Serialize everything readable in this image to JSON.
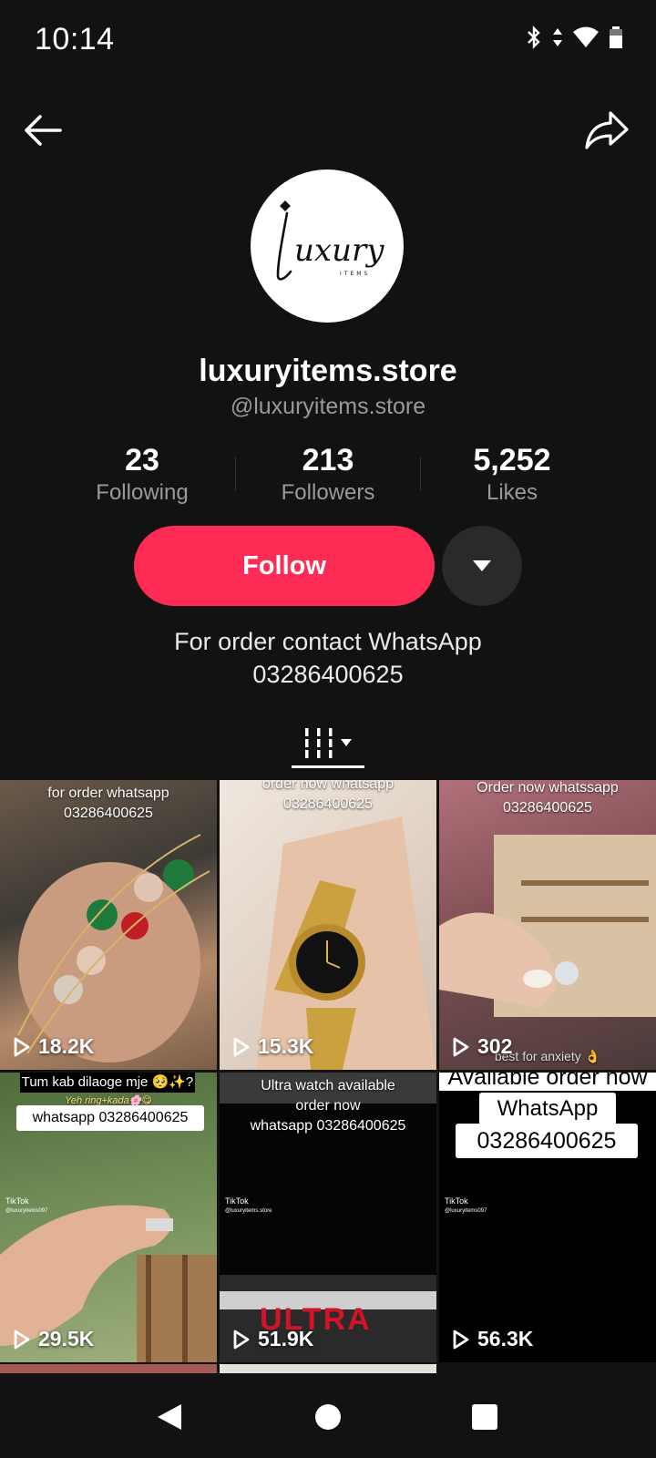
{
  "status_bar": {
    "time": "10:14"
  },
  "profile": {
    "display_name": "luxuryitems.store",
    "handle": "@luxuryitems.store",
    "logo_text": "luxury",
    "logo_subtext": "ITEMS"
  },
  "stats": [
    {
      "value": "23",
      "label": "Following"
    },
    {
      "value": "213",
      "label": "Followers"
    },
    {
      "value": "5,252",
      "label": "Likes"
    }
  ],
  "actions": {
    "follow_label": "Follow"
  },
  "bio": {
    "line1": "For order contact WhatsApp",
    "line2": "03286400625"
  },
  "videos": [
    {
      "caption1": "for order whatsapp",
      "caption2": "03286400625",
      "views": "18.2K"
    },
    {
      "caption1": "order now whatsapp",
      "caption2": "03286400625",
      "views": "15.3K"
    },
    {
      "caption1": "Order now whatssapp",
      "caption2": "03286400625",
      "caption_bottom": "best for anxiety 👌",
      "views": "302"
    },
    {
      "caption1": "Tum kab dilaoge mje 🥺✨?",
      "caption2": "Yeh ring+kada🌸😋",
      "box": "whatsapp 03286400625",
      "watermark": "TikTok",
      "watermark_user": "@luxuryitems097",
      "views": "29.5K"
    },
    {
      "caption1": "Ultra watch available",
      "caption2": "order now",
      "caption3": "whatsapp 03286400625",
      "watermark": "TikTok",
      "watermark_user": "@luxuryitems.store",
      "banner": "ULTRA",
      "views": "51.9K"
    },
    {
      "caption1": "Available order now",
      "box1": "WhatsApp",
      "box2": "03286400625",
      "watermark": "TikTok",
      "watermark_user": "@luxuryitems097",
      "views": "56.3K"
    }
  ],
  "colors": {
    "background": "#121212",
    "accent": "#fe2c55",
    "secondary_text": "#9a9a9a"
  }
}
